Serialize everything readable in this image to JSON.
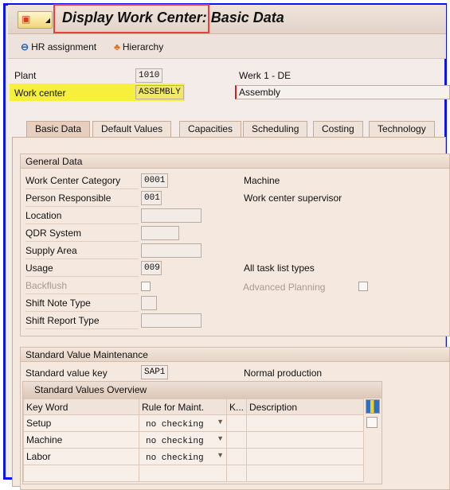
{
  "header": {
    "title": "Display Work Center: Basic Data"
  },
  "toolbar": {
    "hr_assignment": "HR assignment",
    "hierarchy": "Hierarchy"
  },
  "fields": {
    "plant_label": "Plant",
    "plant_value": "1010",
    "plant_desc": "Werk 1 - DE",
    "work_center_label": "Work center",
    "work_center_value": "ASSEMBLY",
    "work_center_desc": "Assembly"
  },
  "tabs": [
    {
      "label": "Basic Data",
      "active": true
    },
    {
      "label": "Default Values"
    },
    {
      "label": "Capacities"
    },
    {
      "label": "Scheduling"
    },
    {
      "label": "Costing"
    },
    {
      "label": "Technology"
    }
  ],
  "general": {
    "title": "General Data",
    "rows": [
      {
        "label": "Work Center Category",
        "value": "0001",
        "desc": "Machine"
      },
      {
        "label": "Person Responsible",
        "value": "001",
        "desc": "Work center supervisor"
      },
      {
        "label": "Location",
        "value": ""
      },
      {
        "label": "QDR System",
        "value": ""
      },
      {
        "label": "Supply Area",
        "value": ""
      },
      {
        "label": "Usage",
        "value": "009",
        "desc": "All task list types"
      },
      {
        "label": "Backflush",
        "desc": "Advanced Planning"
      },
      {
        "label": "Shift Note Type",
        "value": ""
      },
      {
        "label": "Shift Report Type",
        "value": ""
      }
    ]
  },
  "standard": {
    "title": "Standard Value Maintenance",
    "key_label": "Standard value key",
    "key_value": "SAP1",
    "key_desc": "Normal production",
    "overview_title": "Standard Values Overview",
    "columns": [
      "Key Word",
      "Rule for Maint.",
      "K...",
      "Description"
    ],
    "rows": [
      {
        "key": "Setup",
        "rule": "no checking"
      },
      {
        "key": "Machine",
        "rule": "no checking"
      },
      {
        "key": "Labor",
        "rule": "no checking"
      }
    ]
  }
}
